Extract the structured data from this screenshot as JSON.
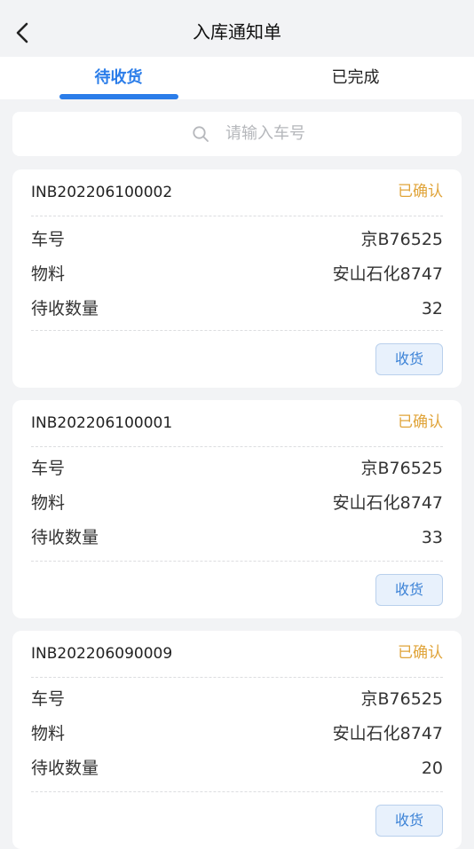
{
  "header": {
    "title": "入库通知单",
    "back_icon": "chevron-left-icon"
  },
  "tabs": [
    {
      "label": "待收货",
      "active": true
    },
    {
      "label": "已完成",
      "active": false
    }
  ],
  "search": {
    "placeholder": "请输入车号",
    "icon": "search-icon"
  },
  "colors": {
    "accent": "#2b7de9",
    "status": "#e0a43a",
    "button_text": "#3b82d6"
  },
  "orders": [
    {
      "no": "INB202206100002",
      "status": "已确认",
      "rows": [
        {
          "label": "车号",
          "value": "京B76525"
        },
        {
          "label": "物料",
          "value": "安山石化8747"
        },
        {
          "label": "待收数量",
          "value": "32"
        }
      ],
      "action": "收货"
    },
    {
      "no": "INB202206100001",
      "status": "已确认",
      "rows": [
        {
          "label": "车号",
          "value": "京B76525"
        },
        {
          "label": "物料",
          "value": "安山石化8747"
        },
        {
          "label": "待收数量",
          "value": "33"
        }
      ],
      "action": "收货"
    },
    {
      "no": "INB202206090009",
      "status": "已确认",
      "rows": [
        {
          "label": "车号",
          "value": "京B76525"
        },
        {
          "label": "物料",
          "value": "安山石化8747"
        },
        {
          "label": "待收数量",
          "value": "20"
        }
      ],
      "action": "收货"
    }
  ]
}
